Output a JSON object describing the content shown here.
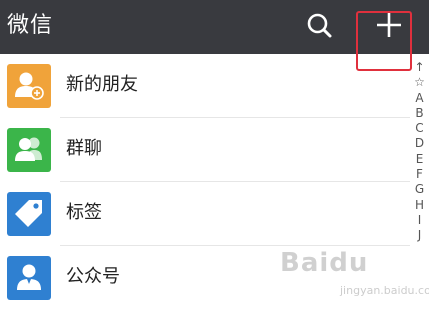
{
  "header": {
    "title": "微信",
    "search_icon": "search-icon",
    "add_icon": "plus-icon",
    "background": "#393a3f"
  },
  "contacts": [
    {
      "label": "新的朋友",
      "icon": "add-friend-icon",
      "color": "#f0a33a"
    },
    {
      "label": "群聊",
      "icon": "group-chat-icon",
      "color": "#3bb54a"
    },
    {
      "label": "标签",
      "icon": "tag-icon",
      "color": "#2f80d1"
    },
    {
      "label": "公众号",
      "icon": "official-account-icon",
      "color": "#2f80d1"
    }
  ],
  "index_bar": [
    "↑",
    "☆",
    "A",
    "B",
    "C",
    "D",
    "E",
    "F",
    "G",
    "H",
    "I",
    "J"
  ],
  "highlight": {
    "target": "plus-icon",
    "color": "#e0303d"
  },
  "watermark": {
    "text": "Baidu",
    "sub": "jingyan.baidu.com"
  }
}
